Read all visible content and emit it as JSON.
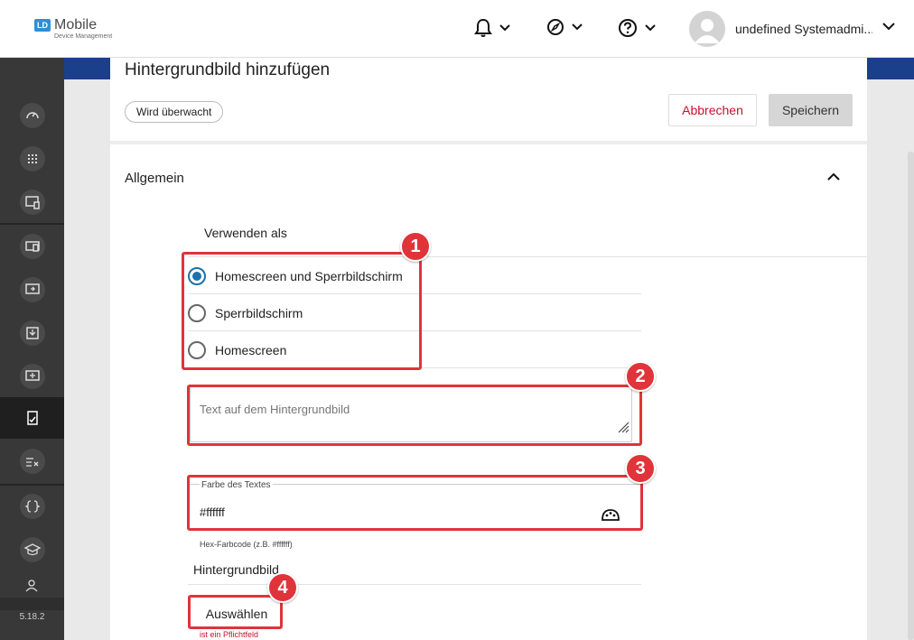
{
  "app": {
    "logo_badge": "LD",
    "logo_name": "Mobile",
    "logo_sub": "Device Management",
    "version": "5.18.2"
  },
  "topbar": {
    "notifications_icon": "bell-icon",
    "compass_icon": "compass-icon",
    "help_icon": "help-icon",
    "username": "undefined Systemadmi..."
  },
  "page": {
    "title": "Hintergrundbild hinzufügen",
    "status_chip": "Wird überwacht",
    "cancel_label": "Abbrechen",
    "save_label": "Speichern"
  },
  "section": {
    "title": "Allgemein",
    "use_as_label": "Verwenden als",
    "options": [
      {
        "label": "Homescreen und Sperrbildschirm",
        "selected": true
      },
      {
        "label": "Sperrbildschirm",
        "selected": false
      },
      {
        "label": "Homescreen",
        "selected": false
      }
    ],
    "text_placeholder": "Text auf dem Hintergrundbild",
    "color_label": "Farbe des Textes",
    "color_value": "#ffffff",
    "color_hint": "Hex-Farbcode (z.B. #ffffff)",
    "background_label": "Hintergrundbild",
    "select_label": "Auswählen",
    "required_msg": "ist ein Pflichtfeld"
  },
  "annotations": [
    "1",
    "2",
    "3",
    "4"
  ],
  "colors": {
    "accent": "#1c72a8",
    "danger": "#c8102e",
    "highlight": "#e0343a",
    "sidebar": "#383838"
  }
}
